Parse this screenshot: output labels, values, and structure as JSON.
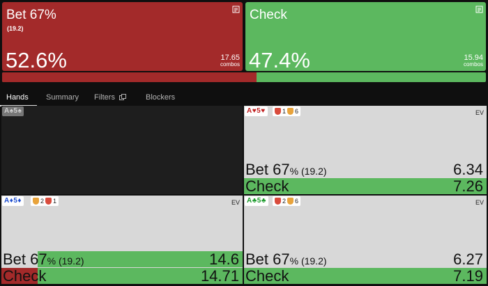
{
  "actions": {
    "bet": {
      "title": "Bet 67%",
      "sub": "(19.2)",
      "pct": "52.6%",
      "combos_num": "17.65",
      "combos_label": "combos",
      "color": "#a32a2a",
      "frequency": 0.526
    },
    "check": {
      "title": "Check",
      "pct": "47.4%",
      "combos_num": "15.94",
      "combos_label": "combos",
      "color": "#5cb85f",
      "frequency": 0.474
    }
  },
  "tabs": {
    "hands": "Hands",
    "summary": "Summary",
    "filters": "Filters",
    "blockers": "Blockers"
  },
  "cells": [
    {
      "hand": {
        "r1": "A",
        "s1": "♠",
        "r2": "5",
        "s2": "♠"
      }
    },
    {
      "hand": {
        "r1": "A",
        "s1": "♥",
        "r2": "5",
        "s2": "♥"
      },
      "blockers": {
        "red": "1",
        "orange": "6"
      },
      "ev_label": "EV",
      "bet": {
        "label": "Bet 67",
        "pct": "%",
        "sizing": " (19.2)",
        "ev": "6.34",
        "fill": 0.0
      },
      "check": {
        "label": "Check",
        "ev": "7.26",
        "fill": 1.0
      }
    },
    {
      "hand": {
        "r1": "A",
        "s1": "♦",
        "r2": "5",
        "s2": "♦"
      },
      "blockers": {
        "red": "2",
        "orange": "1"
      },
      "ev_label": "EV",
      "bet": {
        "label": "Bet 67",
        "pct": "%",
        "sizing": " (19.2)",
        "ev": "14.6",
        "fill": 0.85
      },
      "check": {
        "label": "Check",
        "ev": "14.71",
        "fill": 0.85
      }
    },
    {
      "hand": {
        "r1": "A",
        "s1": "♣",
        "r2": "5",
        "s2": "♣"
      },
      "blockers": {
        "red": "2",
        "orange": "6"
      },
      "ev_label": "EV",
      "bet": {
        "label": "Bet 67",
        "pct": "%",
        "sizing": " (19.2)",
        "ev": "6.27",
        "fill": 0.0
      },
      "check": {
        "label": "Check",
        "ev": "7.19",
        "fill": 1.0
      }
    }
  ]
}
